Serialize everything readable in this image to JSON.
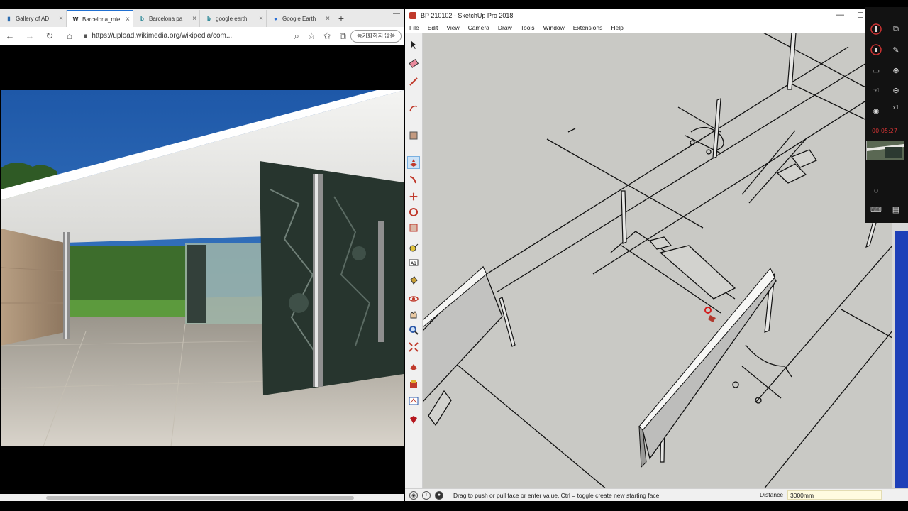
{
  "browser": {
    "tabs": [
      {
        "label": "Gallery of AD",
        "icon": "document-icon"
      },
      {
        "label": "Barcelona_mie",
        "icon": "wikipedia-icon",
        "active": true
      },
      {
        "label": "Barcelona pa",
        "icon": "bing-b-icon"
      },
      {
        "label": "google earth",
        "icon": "bing-b-icon"
      },
      {
        "label": "Google Earth",
        "icon": "globe-icon"
      }
    ],
    "new_tab": "+",
    "url": "https://upload.wikimedia.org/wikipedia/com...",
    "sync_button": "동기화하지 않음"
  },
  "sketchup": {
    "title": "BP 210102 - SketchUp Pro 2018",
    "menu": [
      "File",
      "Edit",
      "View",
      "Camera",
      "Draw",
      "Tools",
      "Window",
      "Extensions",
      "Help"
    ],
    "tools": [
      "select-icon",
      "eraser-icon",
      "line-icon",
      "arc-icon",
      "rectangle-icon",
      "push-pull-icon",
      "follow-me-icon",
      "move-icon",
      "rotate-icon",
      "scale-icon",
      "tape-measure-icon",
      "text-icon",
      "paint-bucket-icon",
      "orbit-icon",
      "pan-icon",
      "zoom-icon",
      "zoom-extents-icon",
      "warehouse-icon",
      "extension-warehouse-icon",
      "layout-icon",
      "ruby-icon"
    ],
    "selected_tool": "push-pull-icon",
    "status_message": "Drag to push or pull face or enter value.  Ctrl = toggle create new starting face.",
    "measure_label": "Distance",
    "measure_value": "3000mm"
  },
  "recorder": {
    "timer": "00:05:27",
    "zoom_multiplier": "x1"
  },
  "colors": {
    "canvas": "#c9c9c5",
    "tab_accent": "#1f6fd1",
    "recorder_bg": "#121212",
    "timer": "#cc3333"
  }
}
